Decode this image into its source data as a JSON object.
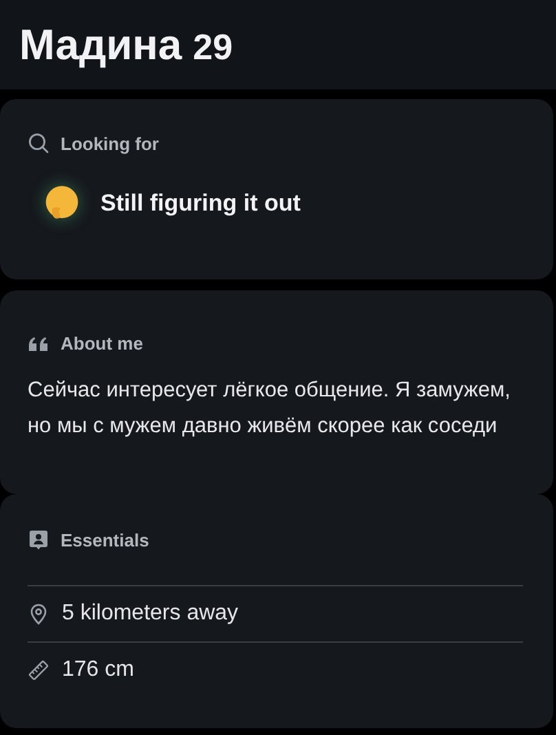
{
  "profile": {
    "name": "Мадина",
    "age": "29"
  },
  "sections": [
    {
      "kind": "looking_for",
      "heading": "Looking for",
      "value": "Still figuring it out"
    },
    {
      "kind": "about",
      "heading": "About me",
      "text": "Сейчас интересует лёгкое общение. Я замужем, но мы с мужем давно живём скорее как соседи"
    },
    {
      "kind": "essentials",
      "heading": "Essentials",
      "items": [
        {
          "kind": "distance",
          "label": "5 kilometers away"
        },
        {
          "kind": "height",
          "label": "176 cm"
        }
      ]
    }
  ]
}
